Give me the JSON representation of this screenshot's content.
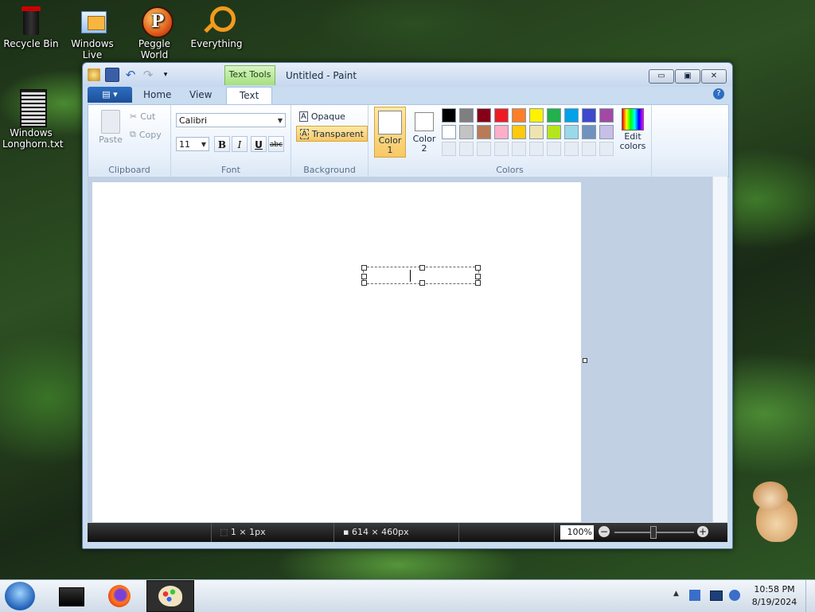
{
  "desktop": {
    "icons": [
      {
        "label": "Recycle Bin",
        "name": "recycle-bin"
      },
      {
        "label": "Windows Live",
        "name": "windows-live"
      },
      {
        "label": "Peggle World",
        "name": "peggle-world"
      },
      {
        "label": "Everything",
        "name": "everything"
      },
      {
        "label": "Windows Longhorn.txt",
        "name": "longhorn-txt"
      }
    ]
  },
  "window": {
    "title": "Untitled - Paint",
    "context_tab": "Text Tools",
    "controls": {
      "minimize": "▭",
      "maximize": "▣",
      "close": "✕"
    }
  },
  "tabs": {
    "home": "Home",
    "view": "View",
    "text": "Text"
  },
  "ribbon": {
    "clipboard": {
      "paste": "Paste",
      "cut": "Cut",
      "copy": "Copy",
      "label": "Clipboard"
    },
    "font": {
      "family": "Calibri",
      "size": "11",
      "bold": "B",
      "italic": "I",
      "underline": "U",
      "strike": "abc",
      "label": "Font"
    },
    "background": {
      "opaque": "Opaque",
      "transparent": "Transparent",
      "label": "Background"
    },
    "colors": {
      "color1": "Color\n1",
      "color1_a": "Color",
      "color1_b": "1",
      "color2_a": "Color",
      "color2_b": "2",
      "edit_a": "Edit",
      "edit_b": "colors",
      "label": "Colors",
      "row1": [
        "#000000",
        "#7f7f7f",
        "#880015",
        "#ed1c24",
        "#ff7f27",
        "#fff200",
        "#22b14c",
        "#00a2e8",
        "#3f48cc",
        "#a349a4"
      ],
      "row2": [
        "#ffffff",
        "#c3c3c3",
        "#b97a57",
        "#ffaec9",
        "#ffc90e",
        "#efe4b0",
        "#b5e61d",
        "#99d9ea",
        "#7092be",
        "#c8bfe7"
      ]
    }
  },
  "status": {
    "cursor": "1 × 1px",
    "canvas_size": "614 × 460px",
    "zoom": "100%"
  },
  "taskbar": {
    "time": "10:58 PM",
    "date": "8/19/2024"
  }
}
